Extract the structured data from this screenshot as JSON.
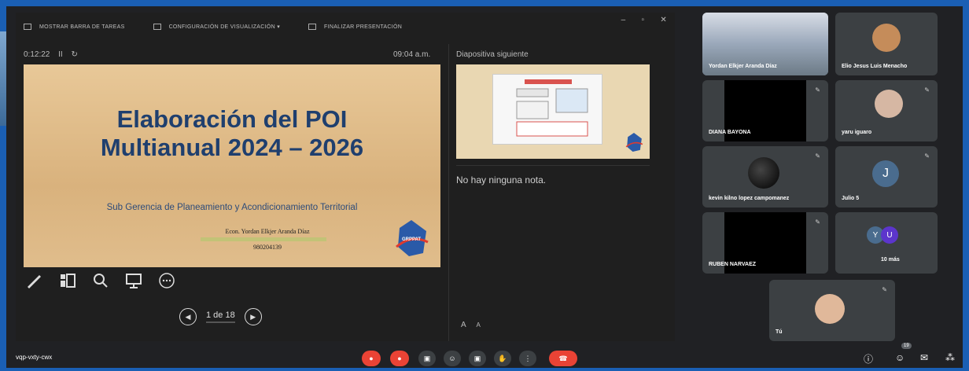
{
  "toolbar": {
    "taskbar": "MOSTRAR BARRA DE TAREAS",
    "display_settings": "CONFIGURACIÓN DE VISUALIZACIÓN ▾",
    "end_show": "FINALIZAR PRESENTACIÓN",
    "win_min": "–",
    "win_restore": "▫",
    "win_close": "✕"
  },
  "presenter": {
    "elapsed": "0:12:22",
    "pause_icon": "II",
    "reset_icon": "↻",
    "clock": "09:04 a.m.",
    "next_label": "Diapositiva siguiente",
    "notes": "No hay ninguna nota.",
    "font_up": "A",
    "font_down": "A",
    "page": "1 de 18"
  },
  "slide": {
    "title_line1": "Elaboración del POI",
    "title_line2": "Multianual 2024 – 2026",
    "subtitle": "Sub Gerencia de Planeamiento y Acondicionamiento Territorial",
    "author": "Econ. Yordan Elkjer Aranda Díaz",
    "phone": "980204139",
    "logo_text": "GRPPAT"
  },
  "participants": [
    {
      "name": "Yordan Elkjer Aranda Díaz"
    },
    {
      "name": "Elio Jesus Luis Menacho"
    },
    {
      "name": "DIANA BAYONA"
    },
    {
      "name": "yaru iguaro"
    },
    {
      "name": "kevin kilno lopez campomanez"
    },
    {
      "name": "Julio 5",
      "initial": "J"
    },
    {
      "name": "RUBEN NARVAEZ"
    },
    {
      "name": "10 más",
      "initials": [
        "Y",
        "U"
      ]
    },
    {
      "name": "Tú"
    }
  ],
  "bottom": {
    "meeting_code": "vqp-vxty-cwx",
    "people_count": "19"
  },
  "colors": {
    "accent_red": "#ea4335",
    "avatar_blue": "#4a6c8e",
    "avatar_purple": "#5c35cc"
  }
}
